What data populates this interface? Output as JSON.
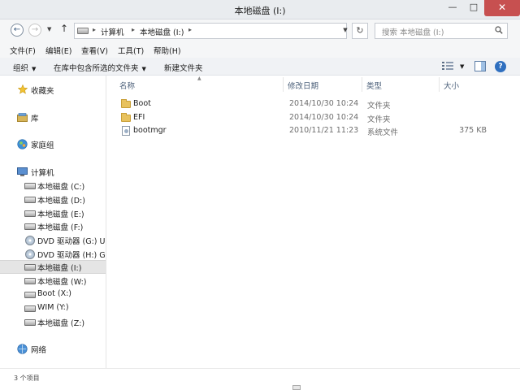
{
  "window": {
    "title": "本地磁盘 (I:)",
    "minimize": "—",
    "maximize": "□",
    "close": "✕"
  },
  "address_bar": {
    "back": "←",
    "forward": "→",
    "recent": "▼",
    "up": "↑",
    "separator": "▸",
    "breadcrumbs": [
      "计算机",
      "本地磁盘 (I:)"
    ],
    "dropdown": "▼",
    "refresh": "↻",
    "search_placeholder": "搜索 本地磁盘 (I:)"
  },
  "menu": [
    "文件(F)",
    "编辑(E)",
    "查看(V)",
    "工具(T)",
    "帮助(H)"
  ],
  "toolbar": {
    "organize": "组织",
    "include_in_library": "在库中包含所选的文件夹",
    "new_folder": "新建文件夹",
    "caret": "▼",
    "help": "?"
  },
  "sidebar": {
    "favorites": "收藏夹",
    "libraries": "库",
    "homegroup": "家庭组",
    "computer": "计算机",
    "drives": [
      {
        "label": "本地磁盘 (C:)",
        "icon": "drive-icon"
      },
      {
        "label": "本地磁盘 (D:)",
        "icon": "drive-icon"
      },
      {
        "label": "本地磁盘 (E:)",
        "icon": "drive-icon"
      },
      {
        "label": "本地磁盘 (F:)",
        "icon": "drive-icon"
      },
      {
        "label": "DVD 驱动器 (G:) U",
        "icon": "dvd-icon"
      },
      {
        "label": "DVD 驱动器 (H:) GS",
        "icon": "dvd-icon"
      },
      {
        "label": "本地磁盘 (I:)",
        "icon": "drive-icon",
        "selected": true
      },
      {
        "label": "本地磁盘 (W:)",
        "icon": "drive-icon"
      },
      {
        "label": "Boot (X:)",
        "icon": "drive-icon"
      },
      {
        "label": "WIM (Y:)",
        "icon": "drive-icon"
      },
      {
        "label": "本地磁盘 (Z:)",
        "icon": "drive-icon"
      }
    ],
    "network": "网络"
  },
  "columns": {
    "name": "名称",
    "modified": "修改日期",
    "type": "类型",
    "size": "大小",
    "sort_caret": "▲"
  },
  "files": [
    {
      "name": "Boot",
      "modified": "2014/10/30 10:24",
      "type": "文件夹",
      "size": "",
      "icon": "folder-icon"
    },
    {
      "name": "EFI",
      "modified": "2014/10/30 10:24",
      "type": "文件夹",
      "size": "",
      "icon": "folder-icon"
    },
    {
      "name": "bootmgr",
      "modified": "2010/11/21 11:23",
      "type": "系统文件",
      "size": "375 KB",
      "icon": "system-file-icon"
    }
  ],
  "status": {
    "item_count": "3 个项目"
  },
  "colors": {
    "close_button": "#c75050",
    "selected_row": "#e5e5e5",
    "folder": "#e8c25e",
    "column_header": "#4c607a"
  }
}
